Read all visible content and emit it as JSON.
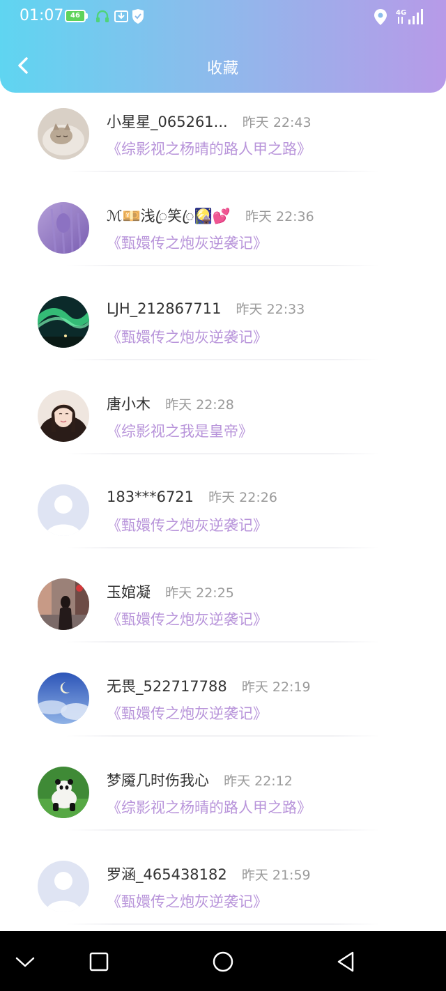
{
  "status_bar": {
    "time": "01:07",
    "battery_level": "46",
    "network": "4G"
  },
  "header": {
    "title": "收藏",
    "accent_gradient": [
      "#5fd5f1",
      "#b79ae8"
    ]
  },
  "favorites": [
    {
      "username": "小星星_065261...",
      "time": "昨天 22:43",
      "book": "《综影视之杨晴的路人甲之路》",
      "avatar": "cat-photo"
    },
    {
      "username": "ℳ💴浅ꦿ笑ꦿ🎑💕",
      "time": "昨天 22:36",
      "book": "《甄嬛传之炮灰逆袭记》",
      "avatar": "purple-photo"
    },
    {
      "username": "LJH_212867711",
      "time": "昨天 22:33",
      "book": "《甄嬛传之炮灰逆袭记》",
      "avatar": "aurora-photo"
    },
    {
      "username": "唐小木",
      "time": "昨天 22:28",
      "book": "《综影视之我是皇帝》",
      "avatar": "portrait-photo"
    },
    {
      "username": "183***6721",
      "time": "昨天 22:26",
      "book": "《甄嬛传之炮灰逆袭记》",
      "avatar": "default-avatar"
    },
    {
      "username": "玉婠凝",
      "time": "昨天 22:25",
      "book": "《甄嬛传之炮灰逆袭记》",
      "avatar": "street-photo"
    },
    {
      "username": "无畏_522717788",
      "time": "昨天 22:19",
      "book": "《甄嬛传之炮灰逆袭记》",
      "avatar": "moon-sky-photo"
    },
    {
      "username": "梦魇几时伤我心",
      "time": "昨天 22:12",
      "book": "《综影视之杨晴的路人甲之路》",
      "avatar": "panda-photo"
    },
    {
      "username": "罗涵_465438182",
      "time": "昨天 21:59",
      "book": "《甄嬛传之炮灰逆袭记》",
      "avatar": "default-avatar"
    }
  ],
  "colors": {
    "username": "#333333",
    "timestamp": "#9a9a9a",
    "book_title": "#b894da"
  }
}
